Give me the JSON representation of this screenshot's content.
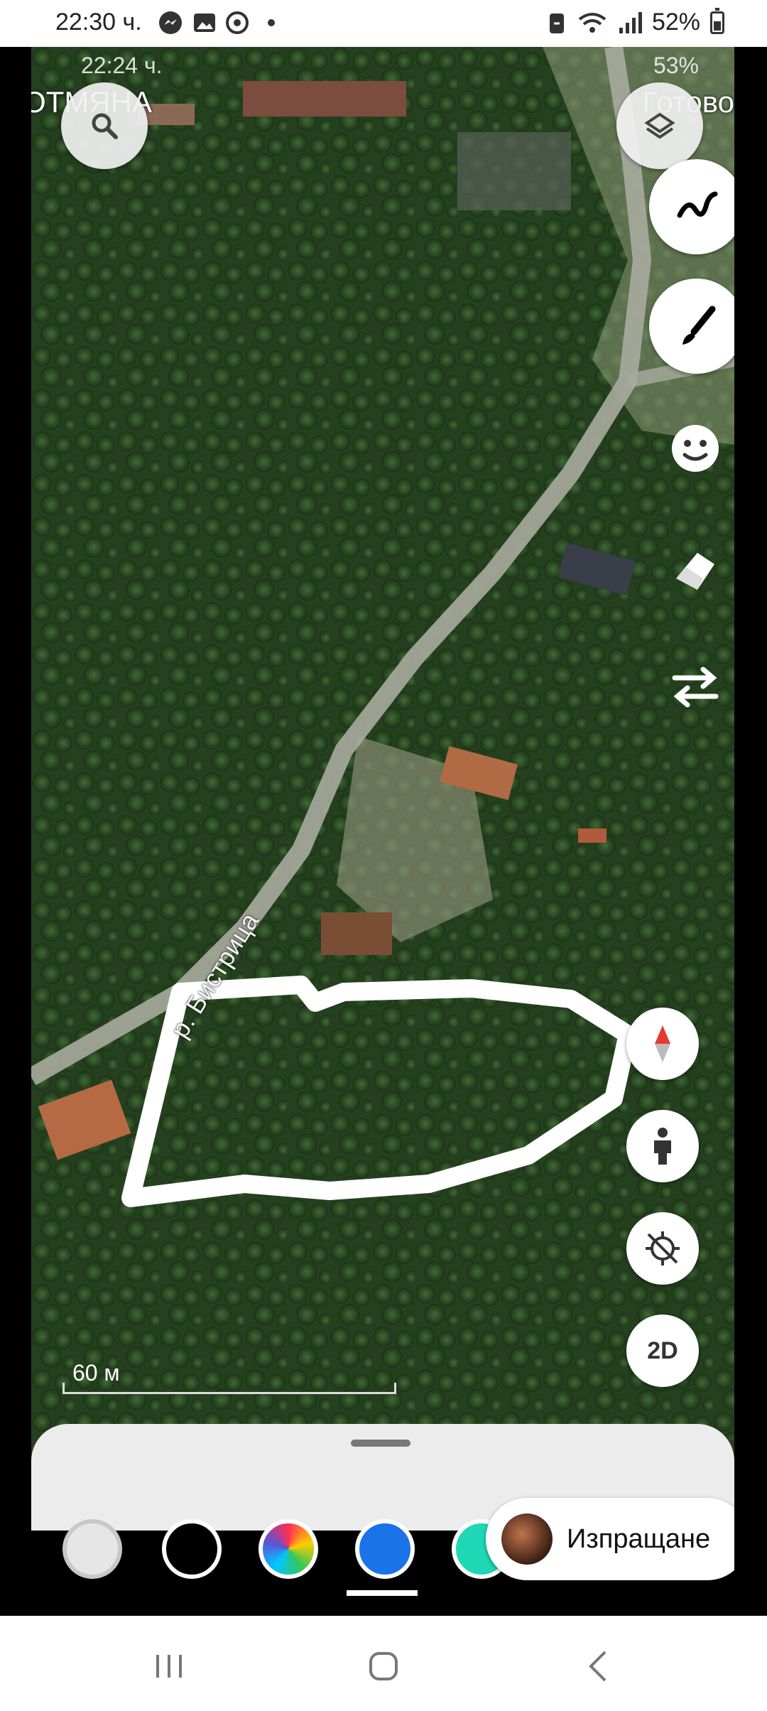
{
  "status_bar": {
    "time": "22:30 ч.",
    "battery": "52%",
    "icons": [
      "messenger-icon",
      "gallery-icon",
      "sync-icon",
      "dot-icon",
      "battery-saver-icon",
      "wifi-icon",
      "signal-icon",
      "battery-icon"
    ]
  },
  "inner_status": {
    "time": "22:24 ч.",
    "battery": "53%"
  },
  "top_actions": {
    "cancel_label": "ОТМЯНА",
    "done_label": "Готово"
  },
  "map": {
    "river_label": "р. Бистрица",
    "scale_label": "60 м",
    "mode_label": "2D"
  },
  "drawing_tools": [
    "squiggle-pen-icon",
    "brush-icon",
    "emoji-icon",
    "eraser-icon",
    "swap-icon"
  ],
  "palette": [
    "#eeeeee",
    "#000000",
    "rainbow",
    "#1a73e8",
    "#1ed7b5"
  ],
  "send": {
    "label": "Изпращане"
  },
  "colors": {
    "drawing_stroke": "#ffffff",
    "sheet": "#ececec"
  }
}
